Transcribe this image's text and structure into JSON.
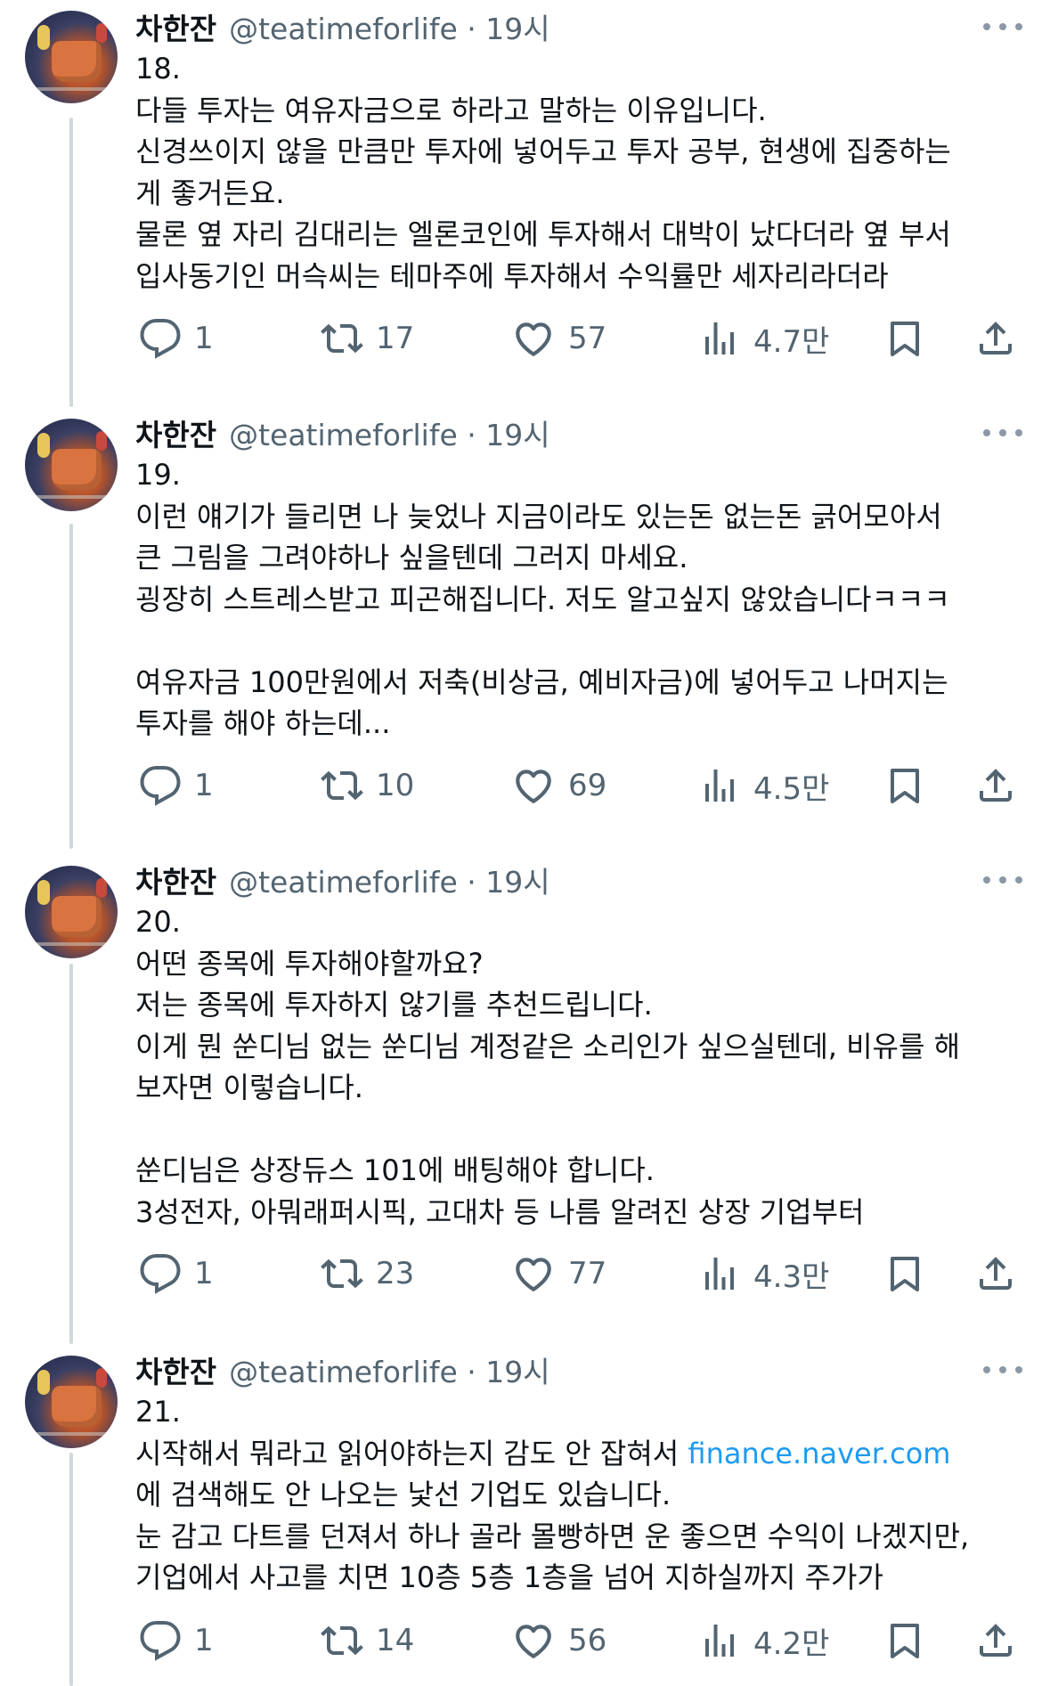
{
  "tweets": [
    {
      "author_name": "차한잔",
      "handle_time": "@teatimeforlife · 19시",
      "number": "18.",
      "lines": [
        "다들 투자는 여유자금으로 하라고 말하는 이유입니다.",
        "신경쓰이지 않을 만큼만 투자에 넣어두고 투자 공부, 현생에 집중하는",
        "게 좋거든요.",
        "물론 옆 자리 김대리는 엘론코인에 투자해서 대박이 났다더라 옆 부서",
        "입사동기인 머슥씨는 테마주에 투자해서 수익률만 세자리라더라"
      ],
      "replies": "1",
      "retweets": "17",
      "likes": "57",
      "views": "4.7만"
    },
    {
      "author_name": "차한잔",
      "handle_time": "@teatimeforlife · 19시",
      "number": "19.",
      "lines": [
        "이런 얘기가 들리면 나 늦었나 지금이라도 있는돈 없는돈 긁어모아서",
        "큰 그림을 그려야하나 싶을텐데 그러지 마세요.",
        "굉장히 스트레스받고 피곤해집니다. 저도 알고싶지 않았습니다ㅋㅋㅋ",
        "",
        "여유자금 100만원에서 저축(비상금, 예비자금)에 넣어두고 나머지는",
        "투자를 해야 하는데..."
      ],
      "replies": "1",
      "retweets": "10",
      "likes": "69",
      "views": "4.5만"
    },
    {
      "author_name": "차한잔",
      "handle_time": "@teatimeforlife · 19시",
      "number": "20.",
      "lines": [
        "어떤 종목에 투자해야할까요?",
        "저는 종목에 투자하지 않기를 추천드립니다.",
        "이게 뭔 쑨디님 없는 쑨디님 계정같은 소리인가 싶으실텐데, 비유를 해",
        "보자면 이렇습니다.",
        "",
        "쑨디님은 상장듀스 101에 배팅해야 합니다.",
        "3성전자, 아뭐래퍼시픽, 고대차 등 나름 알려진 상장 기업부터"
      ],
      "replies": "1",
      "retweets": "23",
      "likes": "77",
      "views": "4.3만"
    },
    {
      "author_name": "차한잔",
      "handle_time": "@teatimeforlife · 19시",
      "number": "21.",
      "line1_text": "시작해서 뭐라고 읽어야하는지 감도 안 잡혀서 ",
      "line1_link": "finance.naver.com",
      "lines": [
        "에 검색해도 안 나오는 낯선 기업도 있습니다.",
        "눈 감고 다트를 던져서 하나 골라 몰빵하면 운 좋으면 수익이 나겠지만,",
        "기업에서 사고를 치면 10층 5층 1층을 넘어 지하실까지 주가가"
      ],
      "replies": "1",
      "retweets": "14",
      "likes": "56",
      "views": "4.2만"
    }
  ],
  "icons": {
    "reply": "reply-icon",
    "retweet": "retweet-icon",
    "like": "heart-icon",
    "views": "views-icon",
    "bookmark": "bookmark-icon",
    "share": "share-icon",
    "more": "more-icon"
  },
  "colors": {
    "link": "#1d9bf0",
    "muted": "#536471",
    "thread_line": "#cfd9de"
  }
}
